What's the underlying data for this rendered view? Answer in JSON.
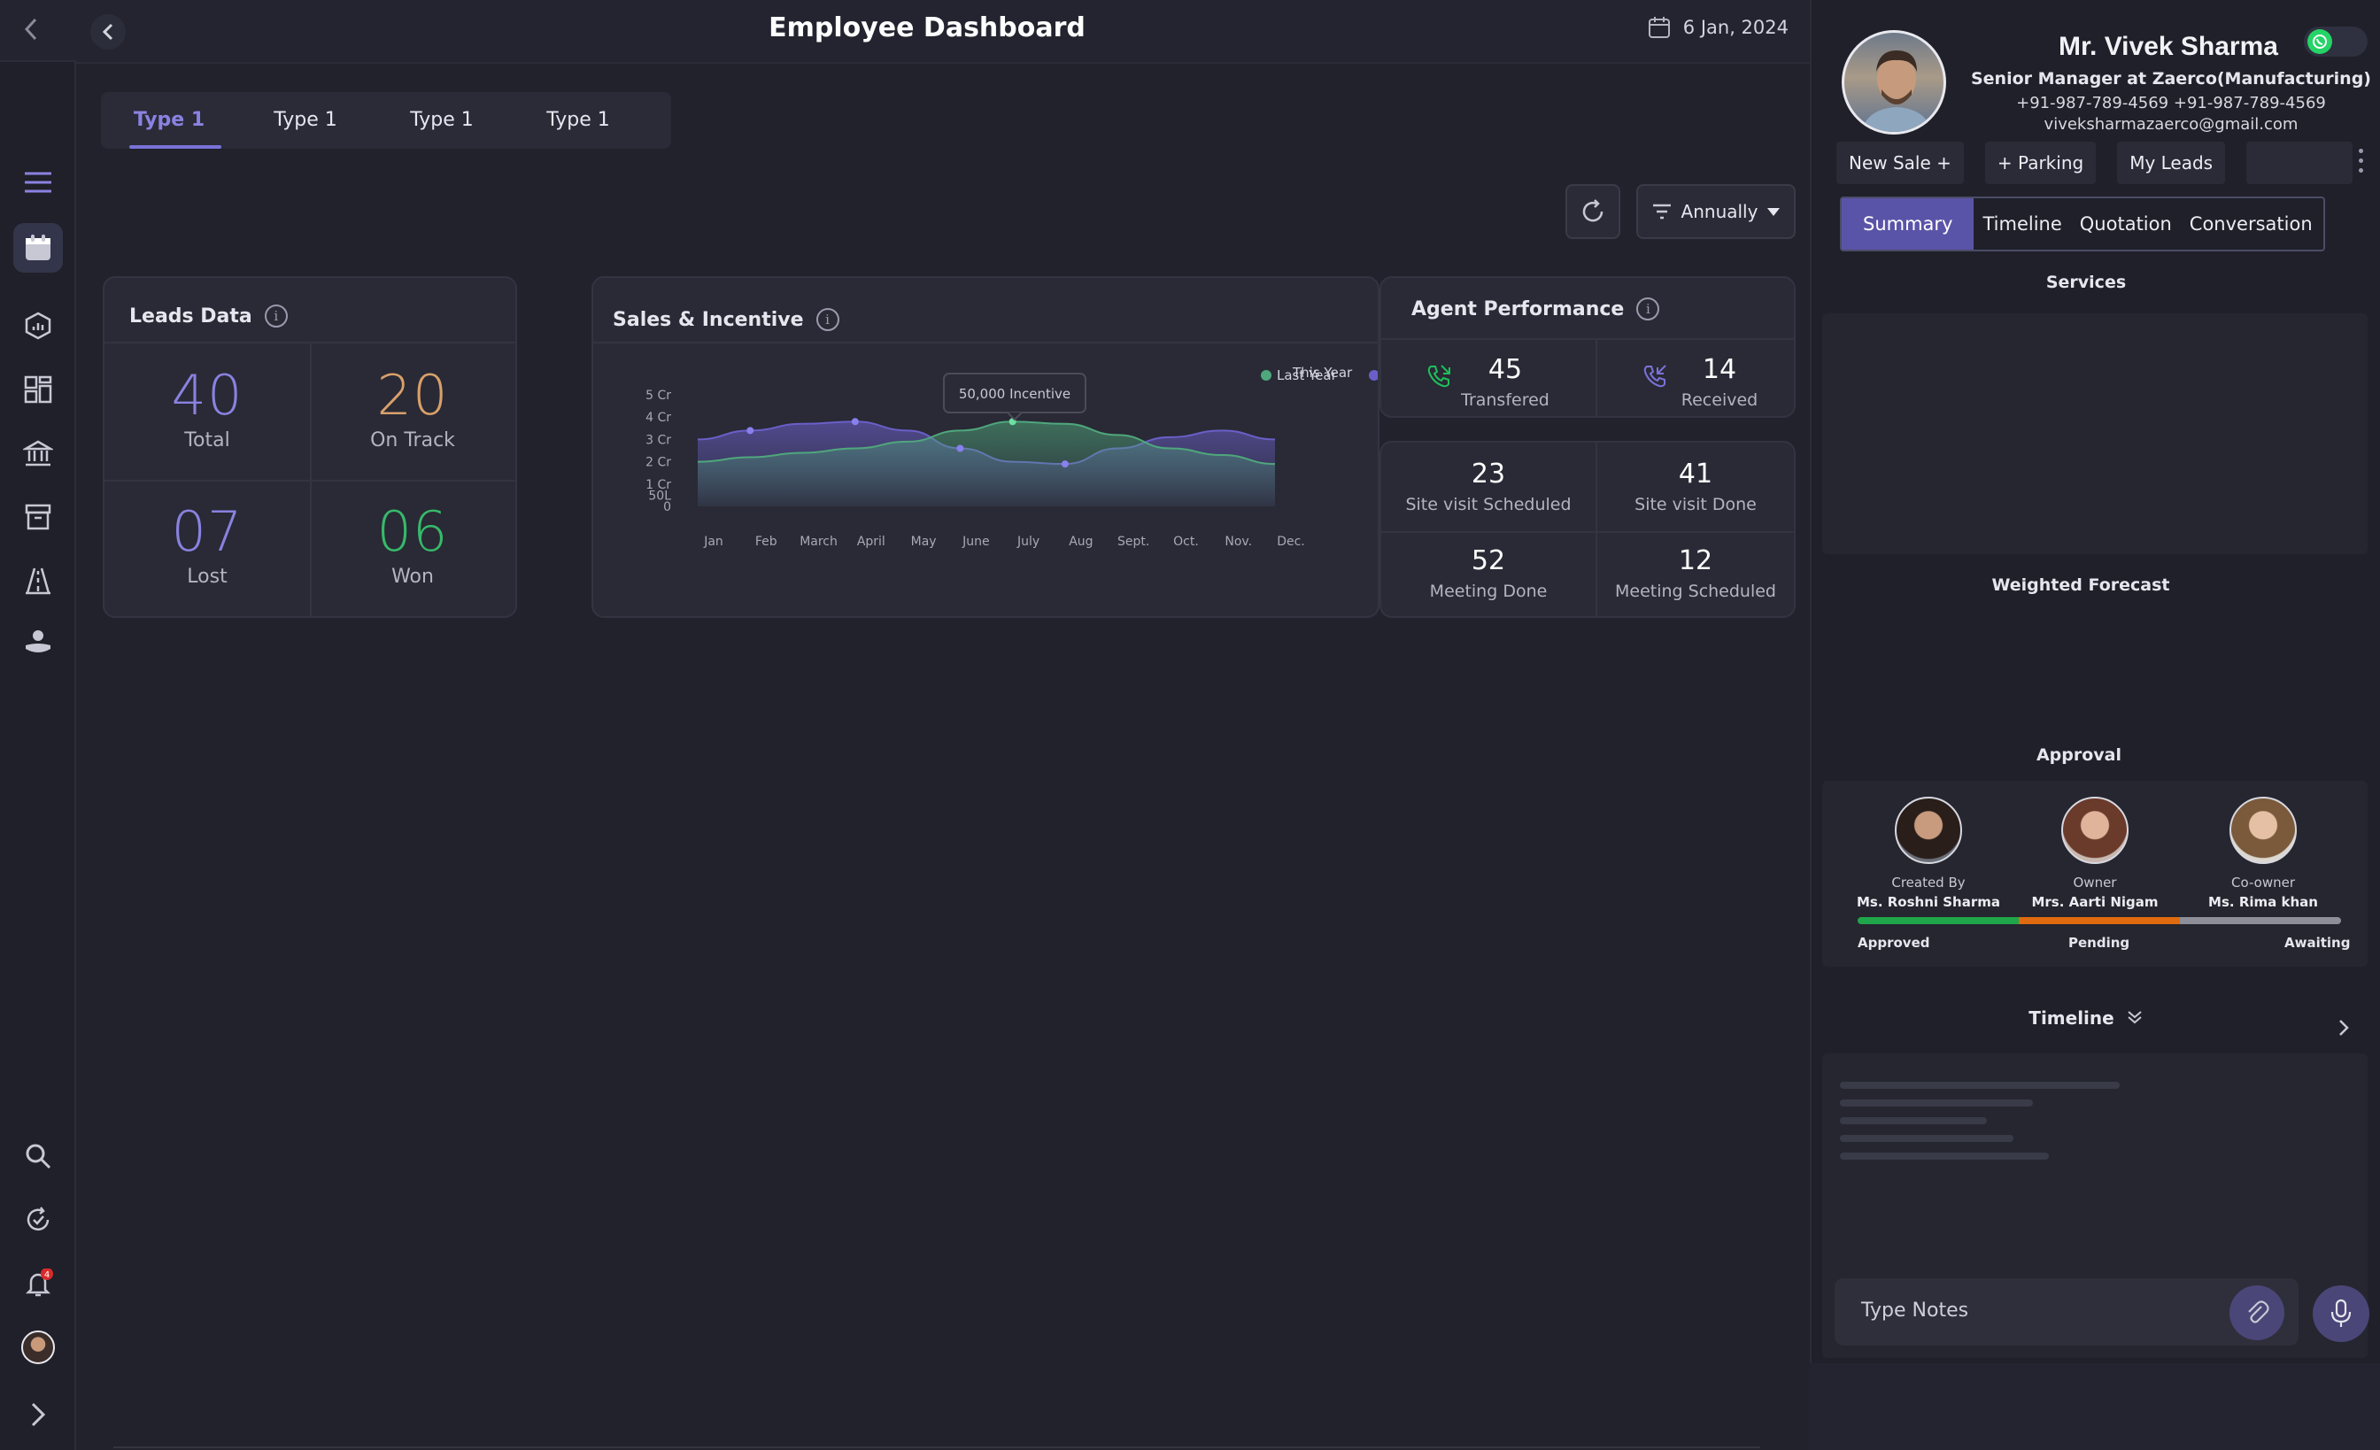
{
  "header": {
    "title": "Employee Dashboard",
    "date": "6 Jan, 2024"
  },
  "tabs": [
    {
      "label": "Type 1",
      "active": true
    },
    {
      "label": "Type 1",
      "active": false
    },
    {
      "label": "Type 1",
      "active": false
    },
    {
      "label": "Type 1",
      "active": false
    }
  ],
  "filter": {
    "period": "Annually"
  },
  "sidebar": {
    "icons": [
      "menu-icon",
      "calendar-icon",
      "analytics-icon",
      "dashboard-icon",
      "bank-icon",
      "archive-icon",
      "road-icon",
      "hand-coin-icon"
    ],
    "bottom_icons": [
      "search-icon",
      "refresh-check-icon",
      "bell-icon",
      "user-avatar",
      "expand-icon"
    ],
    "notification_count": "4"
  },
  "leads": {
    "title": "Leads Data",
    "total": {
      "value": "40",
      "label": "Total",
      "color": "#8a82e0"
    },
    "on_track": {
      "value": "20",
      "label": "On Track",
      "color": "#d9a06a"
    },
    "lost": {
      "value": "07",
      "label": "Lost",
      "color": "#8a82e0"
    },
    "won": {
      "value": "06",
      "label": "Won",
      "color": "#37b96a"
    }
  },
  "sales": {
    "title": "Sales & Incentive",
    "tooltip": "50,000 Incentive",
    "legend": {
      "last_year": "Last Year",
      "this_year": "This Year"
    }
  },
  "chart_data": {
    "type": "area",
    "categories": [
      "Jan",
      "Feb",
      "March",
      "April",
      "May",
      "June",
      "July",
      "Aug",
      "Sept.",
      "Oct.",
      "Nov.",
      "Dec."
    ],
    "y_tick_labels": [
      "0",
      "50L",
      "1 Cr",
      "2 Cr",
      "3 Cr",
      "4 Cr",
      "5 Cr"
    ],
    "series": [
      {
        "name": "Last Year",
        "color": "#4fa77c",
        "values": [
          2.0,
          2.2,
          2.4,
          2.6,
          2.9,
          3.4,
          3.8,
          3.7,
          3.2,
          2.6,
          2.3,
          1.9
        ]
      },
      {
        "name": "This Year",
        "color": "#6a5fc8",
        "values": [
          3.0,
          3.4,
          3.7,
          3.8,
          3.4,
          2.6,
          2.0,
          1.9,
          2.6,
          3.1,
          3.4,
          3.0
        ]
      }
    ],
    "markers": [
      {
        "series": "This Year",
        "x": "Feb",
        "y": 3.4
      },
      {
        "series": "This Year",
        "x": "April",
        "y": 3.8
      },
      {
        "series": "This Year",
        "x": "June",
        "y": 2.6
      },
      {
        "series": "Last Year",
        "x": "July",
        "y": 3.8
      },
      {
        "series": "This Year",
        "x": "Aug",
        "y": 1.9
      }
    ],
    "legend_position": "top-right",
    "grid": false
  },
  "agent": {
    "title": "Agent Performance",
    "transferred": {
      "value": "45",
      "label": "Transfered"
    },
    "received": {
      "value": "14",
      "label": "Received"
    },
    "site_visit_scheduled": {
      "value": "23",
      "label": "Site visit Scheduled"
    },
    "site_visit_done": {
      "value": "41",
      "label": "Site visit Done"
    },
    "meeting_done": {
      "value": "52",
      "label": "Meeting Done"
    },
    "meeting_scheduled": {
      "value": "12",
      "label": "Meeting Scheduled"
    }
  },
  "profile": {
    "name": "Mr. Vivek Sharma",
    "role": "Senior Manager at Zaerco(Manufacturing)",
    "phones": "+91-987-789-4569  +91-987-789-4569",
    "email": "viveksharmazaerco@gmail.com",
    "actions": [
      "New Sale +",
      "+ Parking",
      "My Leads"
    ],
    "tabs": [
      "Summary",
      "Timeline",
      "Quotation",
      "Conversation"
    ],
    "active_tab": "Summary"
  },
  "panel": {
    "services_title": "Services",
    "forecast_title": "Weighted Forecast",
    "approval_title": "Approval",
    "approvers": [
      {
        "role": "Created By",
        "name": "Ms. Roshni Sharma"
      },
      {
        "role": "Owner",
        "name": "Mrs. Aarti  Nigam"
      },
      {
        "role": "Co-owner",
        "name": "Ms. Rima khan"
      }
    ],
    "status": {
      "approved": "Approved",
      "pending": "Pending",
      "awaiting": "Awaiting"
    },
    "status_colors": {
      "approved": "#1fa64a",
      "pending": "#e06a10",
      "awaiting": "#8e8e98"
    },
    "timeline_title": "Timeline",
    "notes_placeholder": "Type Notes"
  }
}
